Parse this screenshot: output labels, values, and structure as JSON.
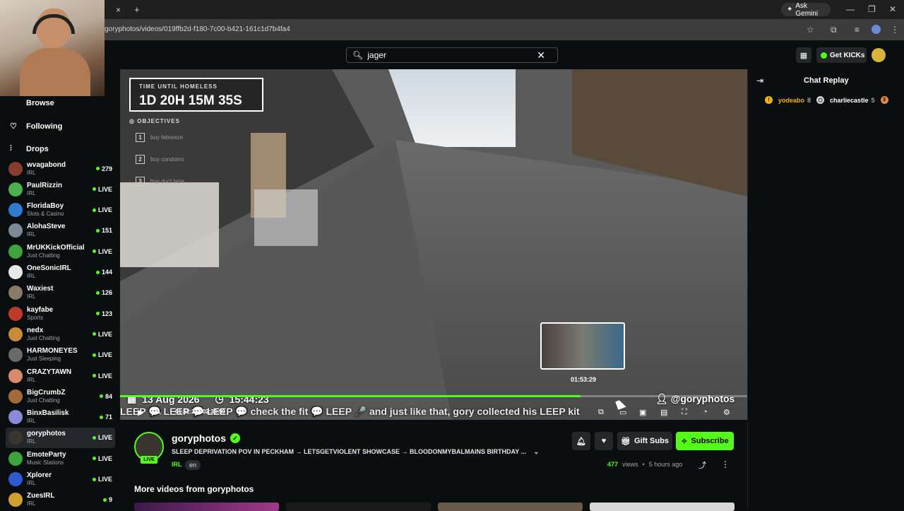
{
  "browser": {
    "url": "goryphotos/videos/019ffb2d-f180-7c00-b421-161c1d7b4fa4",
    "ask_gemini": "Ask Gemini",
    "new_tab": "+",
    "tab_close": "×"
  },
  "header": {
    "search_value": "jager",
    "get_kicks": "Get KICKs"
  },
  "sidebar": {
    "nav": [
      {
        "label": "Browse",
        "icon": "compass-icon"
      },
      {
        "label": "Following",
        "icon": "heart-icon"
      },
      {
        "label": "Drops",
        "icon": "drops-icon"
      }
    ],
    "channels": [
      {
        "name": "wvagabond",
        "category": "IRL",
        "status": "279",
        "color": "#8b3b2e"
      },
      {
        "name": "PaulRizzin",
        "category": "IRL",
        "status": "LIVE",
        "color": "#4caf50"
      },
      {
        "name": "FloridaBoy",
        "category": "Slots & Casino",
        "status": "LIVE",
        "color": "#2f7bd1"
      },
      {
        "name": "AlohaSteve",
        "category": "IRL",
        "status": "151",
        "color": "#7d8a95"
      },
      {
        "name": "MrUKKickOfficial",
        "category": "Just Chatting",
        "status": "LIVE",
        "color": "#3da33d"
      },
      {
        "name": "OneSonicIRL",
        "category": "IRL",
        "status": "144",
        "color": "#e8e8e8"
      },
      {
        "name": "Waxiest",
        "category": "IRL",
        "status": "126",
        "color": "#8a7a6a"
      },
      {
        "name": "kayfabe",
        "category": "Sports",
        "status": "123",
        "color": "#c0392b"
      },
      {
        "name": "nedx",
        "category": "Just Chatting",
        "status": "LIVE",
        "color": "#c98a3a"
      },
      {
        "name": "HARMONEYES",
        "category": "Just Sleeping",
        "status": "LIVE",
        "color": "#6a6a6a"
      },
      {
        "name": "CRAZYTAWN",
        "category": "IRL",
        "status": "LIVE",
        "color": "#d98a6a"
      },
      {
        "name": "BigCrumbZ",
        "category": "Just Chatting",
        "status": "84",
        "color": "#a06a3a"
      },
      {
        "name": "BinxBasilisk",
        "category": "IRL",
        "status": "71",
        "color": "#8a8ad8"
      },
      {
        "name": "goryphotos",
        "category": "IRL",
        "status": "LIVE",
        "color": "#3b3530"
      },
      {
        "name": "EmoteParty",
        "category": "Music Stations",
        "status": "LIVE",
        "color": "#3da33d"
      },
      {
        "name": "Xplorer",
        "category": "IRL",
        "status": "LIVE",
        "color": "#2f5bd1"
      },
      {
        "name": "ZuesIRL",
        "category": "IRL",
        "status": "9",
        "color": "#d1a12f"
      }
    ]
  },
  "video": {
    "hud_label": "TIME UNTIL HOMELESS",
    "hud_timer": "1D 20H 15M 35S",
    "objectives_label": "OBJECTIVES",
    "objectives": [
      "buy febreeze",
      "buy condoms",
      "buy duct tape"
    ],
    "date": "13 Aug 2026",
    "clock": "15:44:23",
    "handle": "@goryphotos",
    "ticker": "LEEP  💬 LEEP  💬 LEEP  💬 check the fit  💬 LEEP  🎤 and just like that, gory collected his LEEP kit",
    "time_current": "01:52:27",
    "time_total": "02:33:50",
    "preview_time": "01:53:29",
    "progress_fraction": 0.734,
    "accent": "#53fc18"
  },
  "info": {
    "channel": "goryphotos",
    "live_badge": "LIVE",
    "title": "SLEEP DEPRIVATION POV IN PECKHAM → LETSGETVIOLENT SHOWCASE → BLOODONMYBALMAINS BIRTHDAY ...",
    "category": "IRL",
    "language": "en",
    "gift_subs": "Gift Subs",
    "subscribe": "Subscribe",
    "views": "477",
    "views_label": "views",
    "ago": "5 hours ago",
    "more_videos": "More videos from goryphotos"
  },
  "chat": {
    "title": "Chat Replay",
    "users": [
      {
        "name": "yodeabo",
        "count": "8",
        "badge_color": "#f5b400"
      },
      {
        "name": "charliecastle",
        "count": "5",
        "badge_color": "#d0d0d0"
      },
      {
        "name": "3",
        "count": "",
        "badge_color": "#e08a3a"
      }
    ]
  }
}
